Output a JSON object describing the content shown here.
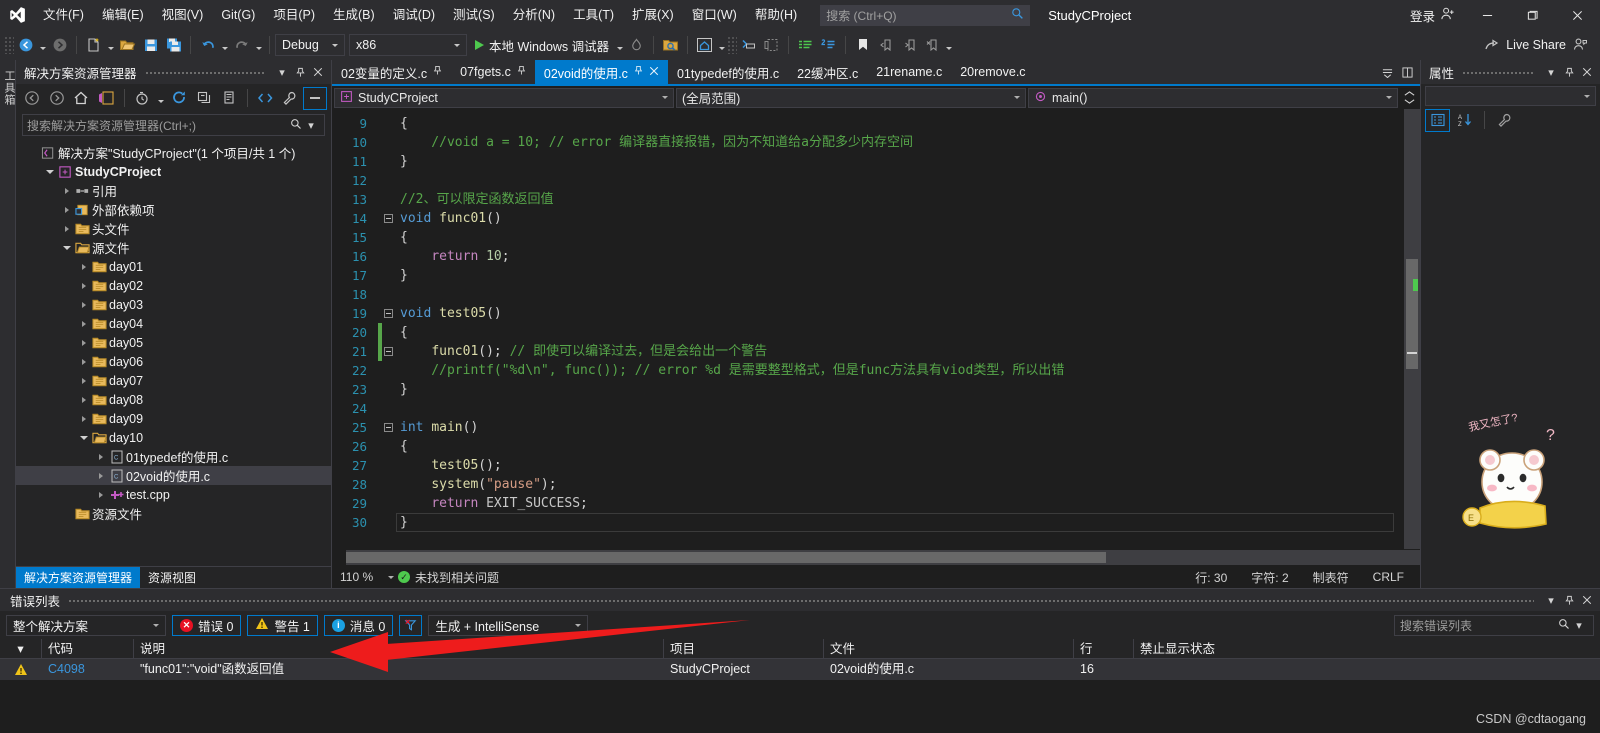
{
  "window": {
    "title": "StudyCProject",
    "login_label": "登录",
    "live_share_label": "Live Share"
  },
  "menu": {
    "items": [
      "文件(F)",
      "编辑(E)",
      "视图(V)",
      "Git(G)",
      "项目(P)",
      "生成(B)",
      "调试(D)",
      "测试(S)",
      "分析(N)",
      "工具(T)",
      "扩展(X)",
      "窗口(W)",
      "帮助(H)"
    ]
  },
  "quick_search": {
    "placeholder": "搜索 (Ctrl+Q)"
  },
  "toolbar": {
    "config": "Debug",
    "platform": "x86",
    "run_label": "本地 Windows 调试器"
  },
  "solution_explorer": {
    "title": "解决方案资源管理器",
    "search_placeholder": "搜索解决方案资源管理器(Ctrl+;)",
    "tree": [
      {
        "label": "解决方案\"StudyCProject\"(1 个项目/共 1 个)",
        "indent": 0,
        "arrow": "none",
        "icon": "solution",
        "bold": false,
        "selected": false
      },
      {
        "label": "StudyCProject",
        "indent": 1,
        "arrow": "open",
        "icon": "project",
        "bold": true,
        "selected": false
      },
      {
        "label": "引用",
        "indent": 2,
        "arrow": "closed",
        "icon": "references",
        "bold": false,
        "selected": false
      },
      {
        "label": "外部依赖项",
        "indent": 2,
        "arrow": "closed",
        "icon": "extdeps",
        "bold": false,
        "selected": false
      },
      {
        "label": "头文件",
        "indent": 2,
        "arrow": "closed",
        "icon": "filter",
        "bold": false,
        "selected": false
      },
      {
        "label": "源文件",
        "indent": 2,
        "arrow": "open",
        "icon": "filter-open",
        "bold": false,
        "selected": false
      },
      {
        "label": "day01",
        "indent": 3,
        "arrow": "closed",
        "icon": "filter",
        "bold": false,
        "selected": false
      },
      {
        "label": "day02",
        "indent": 3,
        "arrow": "closed",
        "icon": "filter",
        "bold": false,
        "selected": false
      },
      {
        "label": "day03",
        "indent": 3,
        "arrow": "closed",
        "icon": "filter",
        "bold": false,
        "selected": false
      },
      {
        "label": "day04",
        "indent": 3,
        "arrow": "closed",
        "icon": "filter",
        "bold": false,
        "selected": false
      },
      {
        "label": "day05",
        "indent": 3,
        "arrow": "closed",
        "icon": "filter",
        "bold": false,
        "selected": false
      },
      {
        "label": "day06",
        "indent": 3,
        "arrow": "closed",
        "icon": "filter",
        "bold": false,
        "selected": false
      },
      {
        "label": "day07",
        "indent": 3,
        "arrow": "closed",
        "icon": "filter",
        "bold": false,
        "selected": false
      },
      {
        "label": "day08",
        "indent": 3,
        "arrow": "closed",
        "icon": "filter",
        "bold": false,
        "selected": false
      },
      {
        "label": "day09",
        "indent": 3,
        "arrow": "closed",
        "icon": "filter",
        "bold": false,
        "selected": false
      },
      {
        "label": "day10",
        "indent": 3,
        "arrow": "open",
        "icon": "filter-open",
        "bold": false,
        "selected": false
      },
      {
        "label": "01typedef的使用.c",
        "indent": 4,
        "arrow": "closed",
        "icon": "cfile",
        "bold": false,
        "selected": false
      },
      {
        "label": "02void的使用.c",
        "indent": 4,
        "arrow": "closed",
        "icon": "cfile",
        "bold": false,
        "selected": true
      },
      {
        "label": "test.cpp",
        "indent": 4,
        "arrow": "closed",
        "icon": "cppfile",
        "bold": false,
        "selected": false
      },
      {
        "label": "资源文件",
        "indent": 2,
        "arrow": "none",
        "icon": "filter",
        "bold": false,
        "selected": false
      }
    ],
    "bottom_tabs": [
      {
        "label": "解决方案资源管理器",
        "active": true
      },
      {
        "label": "资源视图",
        "active": false
      }
    ]
  },
  "document_tabs": [
    {
      "label": "02变量的定义.c",
      "active": false,
      "pinned": true,
      "closable": false
    },
    {
      "label": "07fgets.c",
      "active": false,
      "pinned": true,
      "closable": false
    },
    {
      "label": "02void的使用.c",
      "active": true,
      "pinned": true,
      "closable": true
    },
    {
      "label": "01typedef的使用.c",
      "active": false,
      "pinned": false,
      "closable": false
    },
    {
      "label": "22缓冲区.c",
      "active": false,
      "pinned": false,
      "closable": false
    },
    {
      "label": "21rename.c",
      "active": false,
      "pinned": false,
      "closable": false
    },
    {
      "label": "20remove.c",
      "active": false,
      "pinned": false,
      "closable": false
    }
  ],
  "nav_bar": {
    "project": "StudyCProject",
    "scope": "(全局范围)",
    "member": "main()"
  },
  "code": {
    "lines": [
      {
        "n": "9",
        "fold": "",
        "change": false,
        "indent": 1,
        "tokens": [
          {
            "t": "{",
            "c": "txt"
          }
        ]
      },
      {
        "n": "10",
        "fold": "",
        "change": false,
        "indent": 1,
        "tokens": [
          {
            "t": "    //void a = 10; // error 编译器直接报错，因为不知道给a分配多少内存空间",
            "c": "cm"
          }
        ]
      },
      {
        "n": "11",
        "fold": "",
        "change": false,
        "indent": 1,
        "tokens": [
          {
            "t": "}",
            "c": "txt"
          }
        ]
      },
      {
        "n": "12",
        "fold": "",
        "change": false,
        "indent": 0,
        "tokens": []
      },
      {
        "n": "13",
        "fold": "",
        "change": false,
        "indent": 0,
        "tokens": [
          {
            "t": "//2、可以限定函数返回值",
            "c": "cm"
          }
        ]
      },
      {
        "n": "14",
        "fold": "minus",
        "change": false,
        "indent": 0,
        "tokens": [
          {
            "t": "void",
            "c": "kw"
          },
          {
            "t": " ",
            "c": "txt"
          },
          {
            "t": "func01",
            "c": "fn"
          },
          {
            "t": "()",
            "c": "txt"
          }
        ]
      },
      {
        "n": "15",
        "fold": "",
        "change": false,
        "indent": 1,
        "tokens": [
          {
            "t": "{",
            "c": "txt"
          }
        ]
      },
      {
        "n": "16",
        "fold": "",
        "change": false,
        "indent": 1,
        "tokens": [
          {
            "t": "    ",
            "c": "txt"
          },
          {
            "t": "return",
            "c": "kw2"
          },
          {
            "t": " ",
            "c": "txt"
          },
          {
            "t": "10",
            "c": "num"
          },
          {
            "t": ";",
            "c": "txt"
          }
        ]
      },
      {
        "n": "17",
        "fold": "",
        "change": false,
        "indent": 1,
        "tokens": [
          {
            "t": "}",
            "c": "txt"
          }
        ]
      },
      {
        "n": "18",
        "fold": "",
        "change": false,
        "indent": 0,
        "tokens": []
      },
      {
        "n": "19",
        "fold": "minus",
        "change": false,
        "indent": 0,
        "tokens": [
          {
            "t": "void",
            "c": "kw"
          },
          {
            "t": " ",
            "c": "txt"
          },
          {
            "t": "test05",
            "c": "fn"
          },
          {
            "t": "()",
            "c": "txt"
          }
        ]
      },
      {
        "n": "20",
        "fold": "",
        "change": true,
        "indent": 1,
        "tokens": [
          {
            "t": "{",
            "c": "txt"
          }
        ]
      },
      {
        "n": "21",
        "fold": "minus",
        "change": true,
        "indent": 1,
        "tokens": [
          {
            "t": "    ",
            "c": "txt"
          },
          {
            "t": "func01",
            "c": "fn"
          },
          {
            "t": "(); ",
            "c": "txt"
          },
          {
            "t": "// 即使可以编译过去，但是会给出一个警告",
            "c": "cm"
          }
        ]
      },
      {
        "n": "22",
        "fold": "",
        "change": false,
        "indent": 1,
        "tokens": [
          {
            "t": "    //printf(\"%d\\n\", func()); // error %d 是需要整型格式，但是func方法具有viod类型，所以出错",
            "c": "cm"
          }
        ]
      },
      {
        "n": "23",
        "fold": "",
        "change": false,
        "indent": 1,
        "tokens": [
          {
            "t": "}",
            "c": "txt"
          }
        ]
      },
      {
        "n": "24",
        "fold": "",
        "change": false,
        "indent": 0,
        "tokens": []
      },
      {
        "n": "25",
        "fold": "minus",
        "change": false,
        "indent": 0,
        "tokens": [
          {
            "t": "int",
            "c": "kw"
          },
          {
            "t": " ",
            "c": "txt"
          },
          {
            "t": "main",
            "c": "fn"
          },
          {
            "t": "()",
            "c": "txt"
          }
        ]
      },
      {
        "n": "26",
        "fold": "",
        "change": false,
        "indent": 1,
        "tokens": [
          {
            "t": "{",
            "c": "txt"
          }
        ]
      },
      {
        "n": "27",
        "fold": "",
        "change": false,
        "indent": 1,
        "tokens": [
          {
            "t": "    ",
            "c": "txt"
          },
          {
            "t": "test05",
            "c": "fn"
          },
          {
            "t": "();",
            "c": "txt"
          }
        ]
      },
      {
        "n": "28",
        "fold": "",
        "change": false,
        "indent": 1,
        "tokens": [
          {
            "t": "    ",
            "c": "txt"
          },
          {
            "t": "system",
            "c": "fn"
          },
          {
            "t": "(",
            "c": "txt"
          },
          {
            "t": "\"pause\"",
            "c": "st"
          },
          {
            "t": ");",
            "c": "txt"
          }
        ]
      },
      {
        "n": "29",
        "fold": "",
        "change": false,
        "indent": 1,
        "tokens": [
          {
            "t": "    ",
            "c": "txt"
          },
          {
            "t": "return",
            "c": "kw2"
          },
          {
            "t": " ",
            "c": "txt"
          },
          {
            "t": "EXIT_SUCCESS",
            "c": "mac"
          },
          {
            "t": ";",
            "c": "txt"
          }
        ]
      },
      {
        "n": "30",
        "fold": "",
        "change": false,
        "indent": 1,
        "tokens": [
          {
            "t": "}",
            "c": "txt"
          }
        ]
      }
    ]
  },
  "editor_status": {
    "zoom": "110 %",
    "issues": "未找到相关问题",
    "line": "行: 30",
    "col": "字符: 2",
    "tabs": "制表符",
    "eol": "CRLF"
  },
  "properties": {
    "title": "属性"
  },
  "error_list": {
    "title": "错误列表",
    "scope": "整个解决方案",
    "errors_label": "错误 0",
    "warnings_label": "警告 1",
    "messages_label": "消息 0",
    "build_filter": "生成 + IntelliSense",
    "search_placeholder": "搜索错误列表",
    "columns": [
      "代码",
      "说明",
      "项目",
      "文件",
      "行",
      "禁止显示状态"
    ],
    "rows": [
      {
        "severity": "warning",
        "code": "C4098",
        "description": "\"func01\":\"void\"函数返回值",
        "project": "StudyCProject",
        "file": "02void的使用.c",
        "line": "16",
        "suppression": ""
      }
    ]
  },
  "watermark": {
    "csdn": "CSDN @cdtaogang",
    "mascot_text": "我又怎了?"
  },
  "colors": {
    "accent": "#007acc",
    "warning": "#f0c419",
    "error": "#e81123",
    "comment": "#57a64a",
    "keyword": "#569cd6",
    "arrow_annotation": "#ee1c1c"
  }
}
